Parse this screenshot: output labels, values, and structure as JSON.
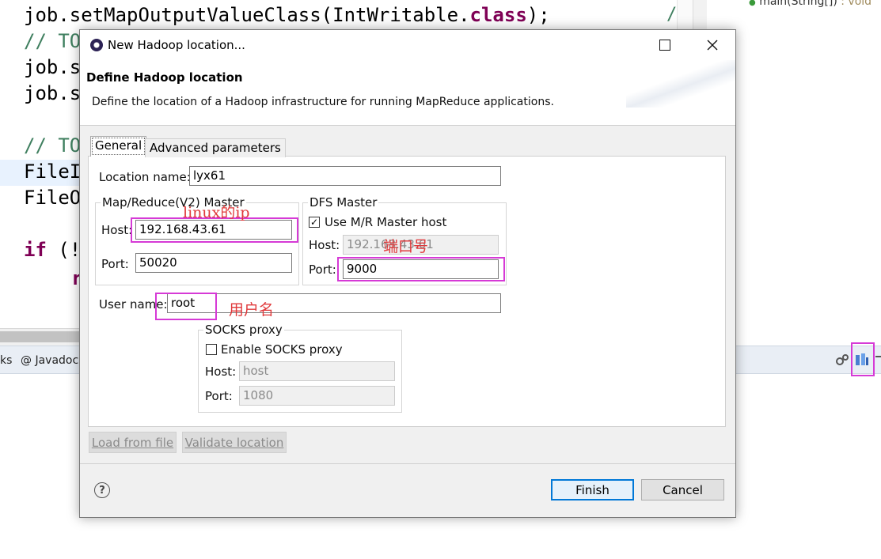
{
  "editor": {
    "code_lines": [
      {
        "pre": "job.setMapOutputValueClass(IntWritable.",
        "kw": "class",
        "post": ");"
      },
      {
        "comment": "// TO"
      },
      {
        "pre": "job.s",
        "kw": "",
        "post": ""
      },
      {
        "pre": "job.s",
        "kw": "",
        "post": ""
      },
      {
        "comment": "// TO"
      },
      {
        "pre": "FileI",
        "kw": "",
        "post": ""
      },
      {
        "pre": "FileO",
        "kw": "",
        "post": ""
      },
      {
        "kw_line": "if",
        "post": " (!"
      },
      {
        "post": "r"
      }
    ],
    "outline_item": "main(String[])",
    "outline_return": ": void",
    "bottom_tabs": [
      "ks",
      "@ Javadoc"
    ]
  },
  "dialog": {
    "title": "New Hadoop location...",
    "header_title": "Define Hadoop location",
    "header_desc": "Define the location of a Hadoop infrastructure for running MapReduce applications.",
    "tabs": [
      "General",
      "Advanced parameters"
    ],
    "location_label": "Location name:",
    "location_value": "lyx61",
    "mr_group": "Map/Reduce(V2) Master",
    "mr_host_label": "Host:",
    "mr_host_value": "192.168.43.61",
    "mr_port_label": "Port:",
    "mr_port_value": "50020",
    "dfs_group": "DFS Master",
    "dfs_use_mr": "Use M/R Master host",
    "dfs_use_mr_checked": true,
    "dfs_host_label": "Host:",
    "dfs_host_value": "192.168.43.61",
    "dfs_port_label": "Port:",
    "dfs_port_value": "9000",
    "user_label": "User name:",
    "user_value": "root",
    "socks_group": "SOCKS proxy",
    "socks_enable": "Enable SOCKS proxy",
    "socks_enable_checked": false,
    "socks_host_label": "Host:",
    "socks_host_value": "host",
    "socks_port_label": "Port:",
    "socks_port_value": "1080",
    "load_btn": "Load from file",
    "validate_btn": "Validate location",
    "finish_btn": "Finish",
    "cancel_btn": "Cancel",
    "help_glyph": "?"
  },
  "annotations": {
    "linux_ip": "linux的ip",
    "port_no": "端口号",
    "username": "用户名"
  },
  "colors": {
    "annotation_box": "#d63ad6",
    "annotation_text": "#e0393b",
    "keyword": "#7f0055",
    "comment": "#3f7f5f",
    "default_button_border": "#0078d7"
  }
}
